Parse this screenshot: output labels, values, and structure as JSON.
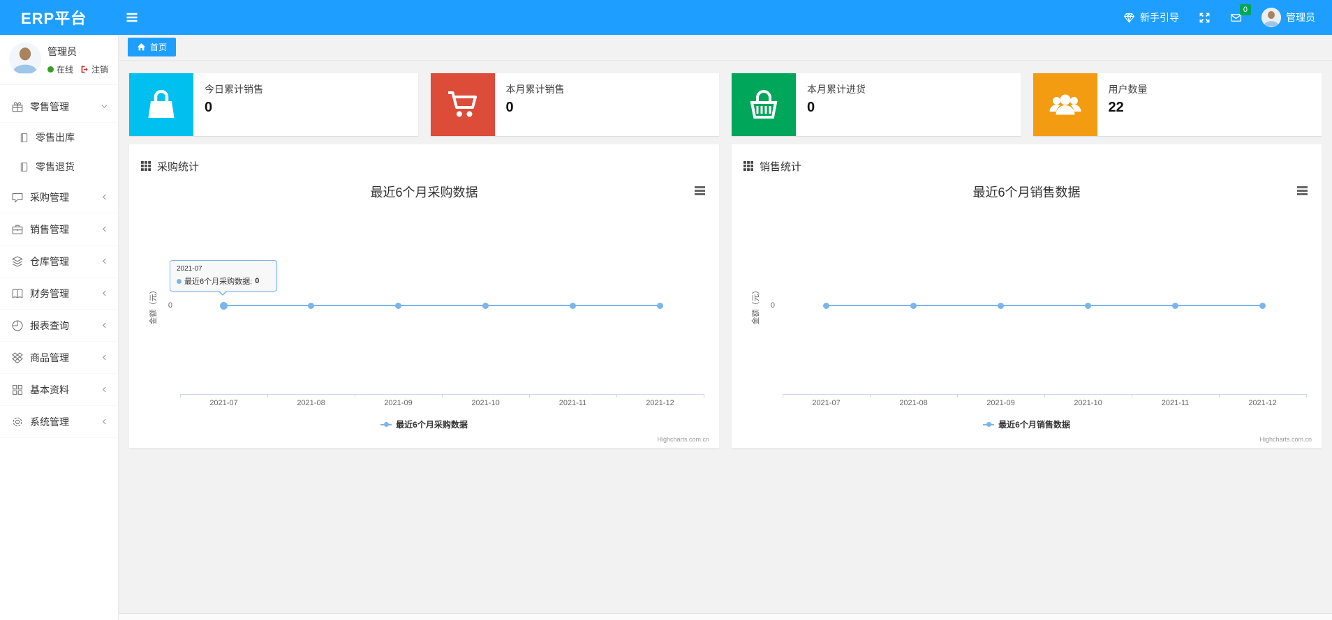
{
  "navbar": {
    "brand": "ERP平台",
    "guide": {
      "label": "新手引导"
    },
    "message": {
      "badge": "0",
      "badge_color": "#00A65A"
    },
    "user": {
      "name": "管理员"
    },
    "bg_color": "#1E9FFF"
  },
  "sidebar": {
    "user": {
      "name": "管理员",
      "status_online": "在线",
      "logout_label": "注销",
      "online_color": "#3a9d23"
    },
    "menu": [
      {
        "id": "retail",
        "label": "零售管理",
        "icon": "gift-icon",
        "chevron": "down",
        "expanded": true,
        "children": [
          {
            "id": "retail-out",
            "label": "零售出库",
            "icon": "doc-icon"
          },
          {
            "id": "retail-return",
            "label": "零售退货",
            "icon": "doc-icon"
          }
        ]
      },
      {
        "id": "purchase",
        "label": "采购管理",
        "icon": "chat-icon",
        "chevron": "left"
      },
      {
        "id": "sales",
        "label": "销售管理",
        "icon": "briefcase-icon",
        "chevron": "left"
      },
      {
        "id": "warehouse",
        "label": "仓库管理",
        "icon": "layers-icon",
        "chevron": "left"
      },
      {
        "id": "finance",
        "label": "财务管理",
        "icon": "book-icon",
        "chevron": "left"
      },
      {
        "id": "report",
        "label": "报表查询",
        "icon": "pie-icon",
        "chevron": "left"
      },
      {
        "id": "goods",
        "label": "商品管理",
        "icon": "box-icon",
        "chevron": "left"
      },
      {
        "id": "basic",
        "label": "基本资料",
        "icon": "grid-icon",
        "chevron": "left"
      },
      {
        "id": "system",
        "label": "系统管理",
        "icon": "gear-icon",
        "chevron": "left"
      }
    ]
  },
  "tabs": [
    {
      "label": "首页",
      "active": true
    }
  ],
  "stat_cards": [
    {
      "label": "今日累计销售",
      "value": "0",
      "color": "#00c0ef",
      "icon": "bag-icon"
    },
    {
      "label": "本月累计销售",
      "value": "0",
      "color": "#dd4b39",
      "icon": "cart-icon"
    },
    {
      "label": "本月累计进货",
      "value": "0",
      "color": "#00a65a",
      "icon": "basket-icon"
    },
    {
      "label": "用户数量",
      "value": "22",
      "color": "#f39c12",
      "icon": "users-icon"
    }
  ],
  "panels": [
    {
      "header": "采购统计"
    },
    {
      "header": "销售统计"
    }
  ],
  "chart_data": [
    {
      "type": "line",
      "title": "最近6个月采购数据",
      "categories": [
        "2021-07",
        "2021-08",
        "2021-09",
        "2021-10",
        "2021-11",
        "2021-12"
      ],
      "series": [
        {
          "name": "最近6个月采购数据",
          "values": [
            0,
            0,
            0,
            0,
            0,
            0
          ],
          "color": "#7cb5ec"
        }
      ],
      "ylabel": "金额（元）",
      "yticks": [
        "0"
      ],
      "ylim": [
        -1,
        1
      ],
      "grid": false,
      "legend_position": "bottom",
      "credit": "Highcharts.com.cn",
      "tooltip": {
        "visible": true,
        "point_index": 0,
        "header": "2021-07",
        "series_label": "最近6个月采购数据: ",
        "value": "0"
      }
    },
    {
      "type": "line",
      "title": "最近6个月销售数据",
      "categories": [
        "2021-07",
        "2021-08",
        "2021-09",
        "2021-10",
        "2021-11",
        "2021-12"
      ],
      "series": [
        {
          "name": "最近6个月销售数据",
          "values": [
            0,
            0,
            0,
            0,
            0,
            0
          ],
          "color": "#7cb5ec"
        }
      ],
      "ylabel": "金额（元）",
      "yticks": [
        "0"
      ],
      "ylim": [
        -1,
        1
      ],
      "grid": false,
      "legend_position": "bottom",
      "credit": "Highcharts.com.cn",
      "tooltip": {
        "visible": false
      }
    }
  ]
}
